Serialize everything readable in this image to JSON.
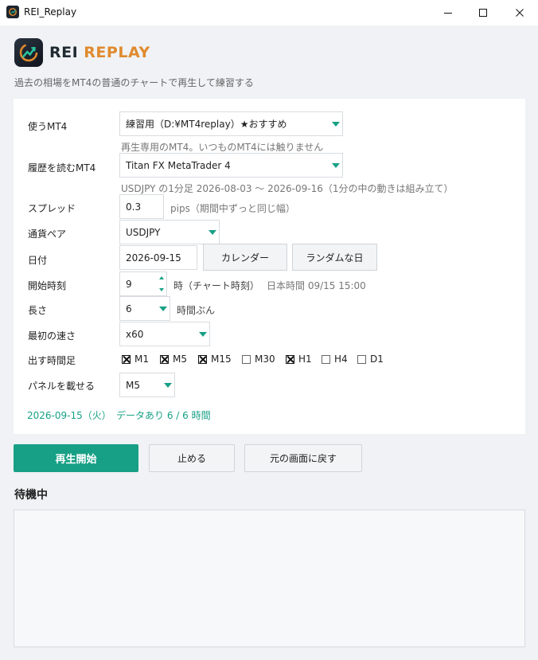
{
  "window": {
    "title": "REI_Replay"
  },
  "header": {
    "brand_part1": "REI ",
    "brand_part2": "REPLAY",
    "tagline": "過去の相場をMT4の普通のチャートで再生して練習する"
  },
  "colors": {
    "accent": "#17a085",
    "brand_orange": "#e08a2e",
    "panel_bg": "#ffffff",
    "app_bg": "#f0f2f5"
  },
  "form": {
    "use_mt4": {
      "label": "使うMT4",
      "value": "練習用（D:¥MT4replay）★おすすめ",
      "hint": "再生専用のMT4。いつものMT4には触りません"
    },
    "history_mt4": {
      "label": "履歴を読むMT4",
      "value": "Titan FX MetaTrader 4",
      "hint": "USDJPY の1分足 2026-08-03 〜 2026-09-16（1分の中の動きは組み立て）"
    },
    "spread": {
      "label": "スプレッド",
      "value": "0.3",
      "unit": "pips（期間中ずっと同じ幅）"
    },
    "pair": {
      "label": "通貨ペア",
      "value": "USDJPY"
    },
    "date": {
      "label": "日付",
      "value": "2026-09-15",
      "calendar_button": "カレンダー",
      "random_button": "ランダムな日"
    },
    "start_time": {
      "label": "開始時刻",
      "value": "9",
      "unit": "時（チャート時刻）",
      "jst_note": "日本時間 09/15 15:00"
    },
    "length": {
      "label": "長さ",
      "value": "6",
      "unit": "時間ぶん"
    },
    "initial_speed": {
      "label": "最初の速さ",
      "value": "x60"
    },
    "timeframes": {
      "label": "出す時間足",
      "items": [
        {
          "name": "M1",
          "checked": true
        },
        {
          "name": "M5",
          "checked": true
        },
        {
          "name": "M15",
          "checked": true
        },
        {
          "name": "M30",
          "checked": false
        },
        {
          "name": "H1",
          "checked": true
        },
        {
          "name": "H4",
          "checked": false
        },
        {
          "name": "D1",
          "checked": false
        }
      ]
    },
    "panel_tf": {
      "label": "パネルを載せる",
      "value": "M5"
    },
    "status": {
      "date": "2026-09-15（火）",
      "data": "データあり 6 / 6 時間"
    }
  },
  "actions": {
    "start": "再生開始",
    "stop": "止める",
    "restore": "元の画面に戻す"
  },
  "log": {
    "title": "待機中"
  }
}
